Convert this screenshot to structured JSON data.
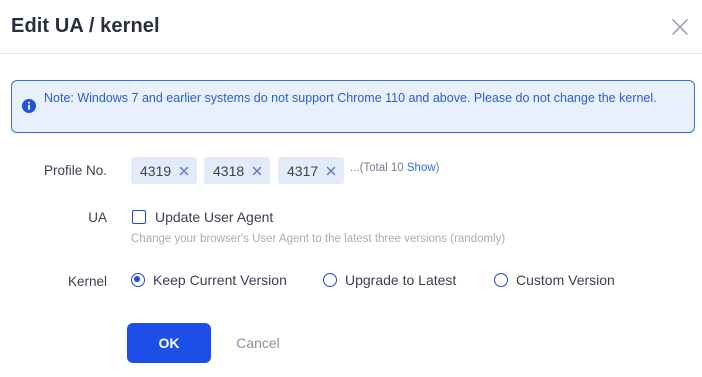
{
  "dialog": {
    "title": "Edit UA / kernel",
    "close_icon": "close-icon"
  },
  "notice": {
    "icon": "info-icon",
    "text": "Note: Windows 7 and earlier systems do not support Chrome 110 and above. Please do not change the kernel."
  },
  "profile": {
    "label": "Profile No.",
    "tags": [
      "4319",
      "4318",
      "4317"
    ],
    "more_prefix": "...(Total 10 ",
    "more_link": "Show",
    "more_suffix": ")"
  },
  "ua": {
    "label": "UA",
    "checkbox_label": "Update User Agent",
    "checked": false,
    "hint": "Change your browser's User Agent to the latest three versions (randomly)"
  },
  "kernel": {
    "label": "Kernel",
    "options": [
      "Keep Current Version",
      "Upgrade to Latest",
      "Custom Version"
    ],
    "selected": "Keep Current Version"
  },
  "footer": {
    "ok_label": "OK",
    "cancel_label": "Cancel"
  },
  "colors": {
    "accent": "#1d4ee8",
    "notice_bg": "#e9f0fd",
    "notice_border": "#2f6fde",
    "tag_bg": "#e3ebfa"
  }
}
